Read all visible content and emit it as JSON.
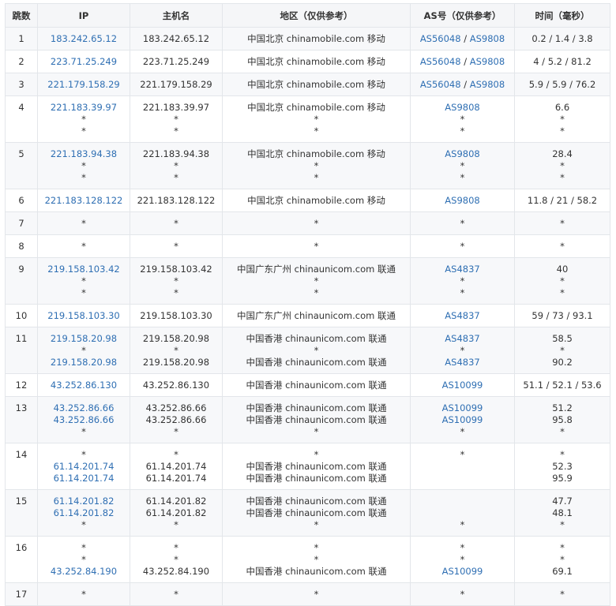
{
  "headers": [
    "跳数",
    "IP",
    "主机名",
    "地区（仅供参考）",
    "AS号（仅供参考）",
    "时间（毫秒）"
  ],
  "rows": [
    {
      "hop": "1",
      "ip": [
        "183.242.65.12"
      ],
      "host": [
        "183.242.65.12"
      ],
      "region": [
        "中国北京 chinamobile.com 移动"
      ],
      "as": [
        [
          "AS56048",
          "AS9808"
        ]
      ],
      "time": [
        "0.2 / 1.4 / 3.8"
      ]
    },
    {
      "hop": "2",
      "ip": [
        "223.71.25.249"
      ],
      "host": [
        "223.71.25.249"
      ],
      "region": [
        "中国北京 chinamobile.com 移动"
      ],
      "as": [
        [
          "AS56048",
          "AS9808"
        ]
      ],
      "time": [
        "4 / 5.2 / 81.2"
      ]
    },
    {
      "hop": "3",
      "ip": [
        "221.179.158.29"
      ],
      "host": [
        "221.179.158.29"
      ],
      "region": [
        "中国北京 chinamobile.com 移动"
      ],
      "as": [
        [
          "AS56048",
          "AS9808"
        ]
      ],
      "time": [
        "5.9 / 5.9 / 76.2"
      ]
    },
    {
      "hop": "4",
      "ip": [
        "221.183.39.97",
        "*",
        "*"
      ],
      "host": [
        "221.183.39.97",
        "*",
        "*"
      ],
      "region": [
        "中国北京 chinamobile.com 移动",
        "*",
        "*"
      ],
      "as": [
        [
          "AS9808"
        ],
        [
          "*"
        ],
        [
          "*"
        ]
      ],
      "time": [
        "6.6",
        "*",
        "*"
      ]
    },
    {
      "hop": "5",
      "ip": [
        "221.183.94.38",
        "*",
        "*"
      ],
      "host": [
        "221.183.94.38",
        "*",
        "*"
      ],
      "region": [
        "中国北京 chinamobile.com 移动",
        "*",
        "*"
      ],
      "as": [
        [
          "AS9808"
        ],
        [
          "*"
        ],
        [
          "*"
        ]
      ],
      "time": [
        "28.4",
        "*",
        "*"
      ]
    },
    {
      "hop": "6",
      "ip": [
        "221.183.128.122"
      ],
      "host": [
        "221.183.128.122"
      ],
      "region": [
        "中国北京 chinamobile.com 移动"
      ],
      "as": [
        [
          "AS9808"
        ]
      ],
      "time": [
        "11.8 / 21 / 58.2"
      ]
    },
    {
      "hop": "7",
      "ip": [
        "*"
      ],
      "host": [
        "*"
      ],
      "region": [
        "*"
      ],
      "as": [
        [
          "*"
        ]
      ],
      "time": [
        "*"
      ]
    },
    {
      "hop": "8",
      "ip": [
        "*"
      ],
      "host": [
        "*"
      ],
      "region": [
        "*"
      ],
      "as": [
        [
          "*"
        ]
      ],
      "time": [
        "*"
      ]
    },
    {
      "hop": "9",
      "ip": [
        "219.158.103.42",
        "*",
        "*"
      ],
      "host": [
        "219.158.103.42",
        "*",
        "*"
      ],
      "region": [
        "中国广东广州 chinaunicom.com 联通",
        "*",
        "*"
      ],
      "as": [
        [
          "AS4837"
        ],
        [
          "*"
        ],
        [
          "*"
        ]
      ],
      "time": [
        "40",
        "*",
        "*"
      ]
    },
    {
      "hop": "10",
      "ip": [
        "219.158.103.30"
      ],
      "host": [
        "219.158.103.30"
      ],
      "region": [
        "中国广东广州 chinaunicom.com 联通"
      ],
      "as": [
        [
          "AS4837"
        ]
      ],
      "time": [
        "59 / 73 / 93.1"
      ]
    },
    {
      "hop": "11",
      "ip": [
        "219.158.20.98",
        "*",
        "219.158.20.98"
      ],
      "host": [
        "219.158.20.98",
        "*",
        "219.158.20.98"
      ],
      "region": [
        "中国香港 chinaunicom.com 联通",
        "*",
        "中国香港 chinaunicom.com 联通"
      ],
      "as": [
        [
          "AS4837"
        ],
        [
          "*"
        ],
        [
          "AS4837"
        ]
      ],
      "time": [
        "58.5",
        "*",
        "90.2"
      ]
    },
    {
      "hop": "12",
      "ip": [
        "43.252.86.130"
      ],
      "host": [
        "43.252.86.130"
      ],
      "region": [
        "中国香港 chinaunicom.com 联通"
      ],
      "as": [
        [
          "AS10099"
        ]
      ],
      "time": [
        "51.1 / 52.1 / 53.6"
      ]
    },
    {
      "hop": "13",
      "ip": [
        "43.252.86.66",
        "43.252.86.66",
        "*"
      ],
      "host": [
        "43.252.86.66",
        "43.252.86.66",
        "*"
      ],
      "region": [
        "中国香港 chinaunicom.com 联通",
        "中国香港 chinaunicom.com 联通",
        "*"
      ],
      "as": [
        [
          "AS10099"
        ],
        [
          "AS10099"
        ],
        [
          "*"
        ]
      ],
      "time": [
        "51.2",
        "95.8",
        "*"
      ]
    },
    {
      "hop": "14",
      "ip": [
        "*",
        "61.14.201.74",
        "61.14.201.74"
      ],
      "host": [
        "*",
        "61.14.201.74",
        "61.14.201.74"
      ],
      "region": [
        "*",
        "中国香港 chinaunicom.com 联通",
        "中国香港 chinaunicom.com 联通"
      ],
      "as": [
        [
          "*"
        ],
        [
          ""
        ],
        [
          ""
        ]
      ],
      "time": [
        "*",
        "52.3",
        "95.9"
      ]
    },
    {
      "hop": "15",
      "ip": [
        "61.14.201.82",
        "61.14.201.82",
        "*"
      ],
      "host": [
        "61.14.201.82",
        "61.14.201.82",
        "*"
      ],
      "region": [
        "中国香港 chinaunicom.com 联通",
        "中国香港 chinaunicom.com 联通",
        "*"
      ],
      "as": [
        [
          ""
        ],
        [
          ""
        ],
        [
          "*"
        ]
      ],
      "time": [
        "47.7",
        "48.1",
        "*"
      ]
    },
    {
      "hop": "16",
      "ip": [
        "*",
        "*",
        "43.252.84.190"
      ],
      "host": [
        "*",
        "*",
        "43.252.84.190"
      ],
      "region": [
        "*",
        "*",
        "中国香港 chinaunicom.com 联通"
      ],
      "as": [
        [
          "*"
        ],
        [
          "*"
        ],
        [
          "AS10099"
        ]
      ],
      "time": [
        "*",
        "*",
        "69.1"
      ]
    },
    {
      "hop": "17",
      "ip": [
        "*"
      ],
      "host": [
        "*"
      ],
      "region": [
        "*"
      ],
      "as": [
        [
          "*"
        ]
      ],
      "time": [
        "*"
      ]
    }
  ]
}
